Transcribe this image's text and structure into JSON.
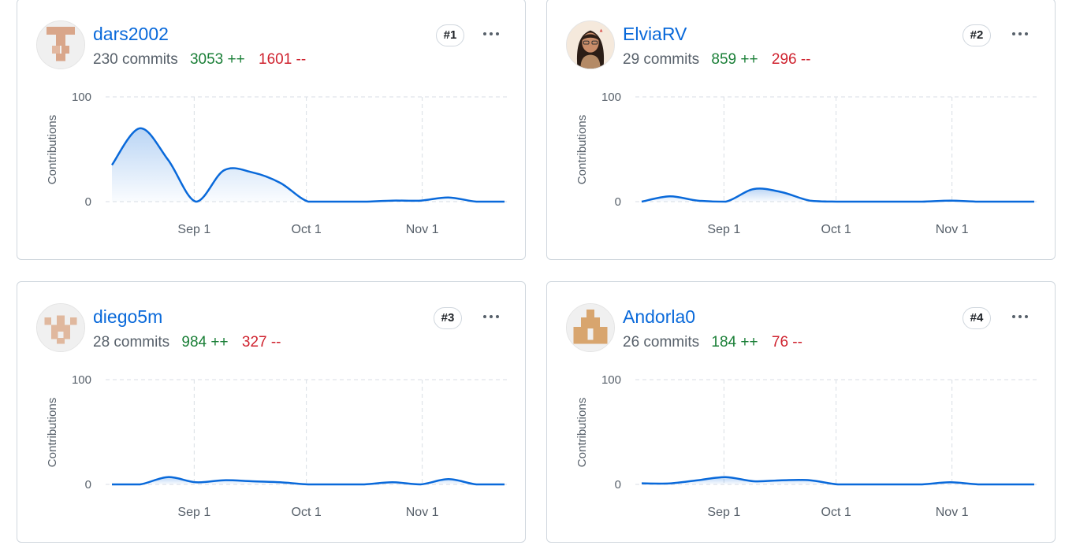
{
  "chart_defaults": {
    "ylabel": "Contributions",
    "y_ticks": [
      "100",
      "0"
    ],
    "x_ticks": [
      "Sep 1",
      "Oct 1",
      "Nov 1"
    ],
    "x_tick_days": [
      22,
      52,
      83
    ],
    "ylim": [
      0,
      100
    ],
    "line_color": "#0969da"
  },
  "contributors": [
    {
      "username": "dars2002",
      "commits": "230 commits",
      "additions": "3053 ++",
      "deletions": "1601 --",
      "rank": "#1",
      "avatar": "identicon-avatar",
      "chart_data": {
        "type": "area",
        "series": [
          {
            "values": [
              35,
              70,
              40,
              0,
              30,
              28,
              18,
              0,
              0,
              0,
              1,
              1,
              4,
              0,
              0
            ]
          }
        ]
      }
    },
    {
      "username": "ElviaRV",
      "commits": "29 commits",
      "additions": "859 ++",
      "deletions": "296 --",
      "rank": "#2",
      "avatar": "photo-avatar",
      "chart_data": {
        "type": "area",
        "series": [
          {
            "values": [
              0,
              5,
              1,
              0,
              12,
              9,
              1,
              0,
              0,
              0,
              0,
              1,
              0,
              0,
              0
            ]
          }
        ]
      }
    },
    {
      "username": "diego5m",
      "commits": "28 commits",
      "additions": "984 ++",
      "deletions": "327 --",
      "rank": "#3",
      "avatar": "identicon-avatar",
      "chart_data": {
        "type": "area",
        "series": [
          {
            "values": [
              0,
              0,
              7,
              2,
              4,
              3,
              2,
              0,
              0,
              0,
              2,
              0,
              5,
              0,
              0
            ]
          }
        ]
      }
    },
    {
      "username": "Andorla0",
      "commits": "26 commits",
      "additions": "184 ++",
      "deletions": "76 --",
      "rank": "#4",
      "avatar": "identicon-avatar",
      "chart_data": {
        "type": "area",
        "series": [
          {
            "values": [
              1,
              1,
              4,
              7,
              3,
              4,
              4,
              0,
              0,
              0,
              0,
              2,
              0,
              0,
              0
            ]
          }
        ]
      }
    }
  ]
}
